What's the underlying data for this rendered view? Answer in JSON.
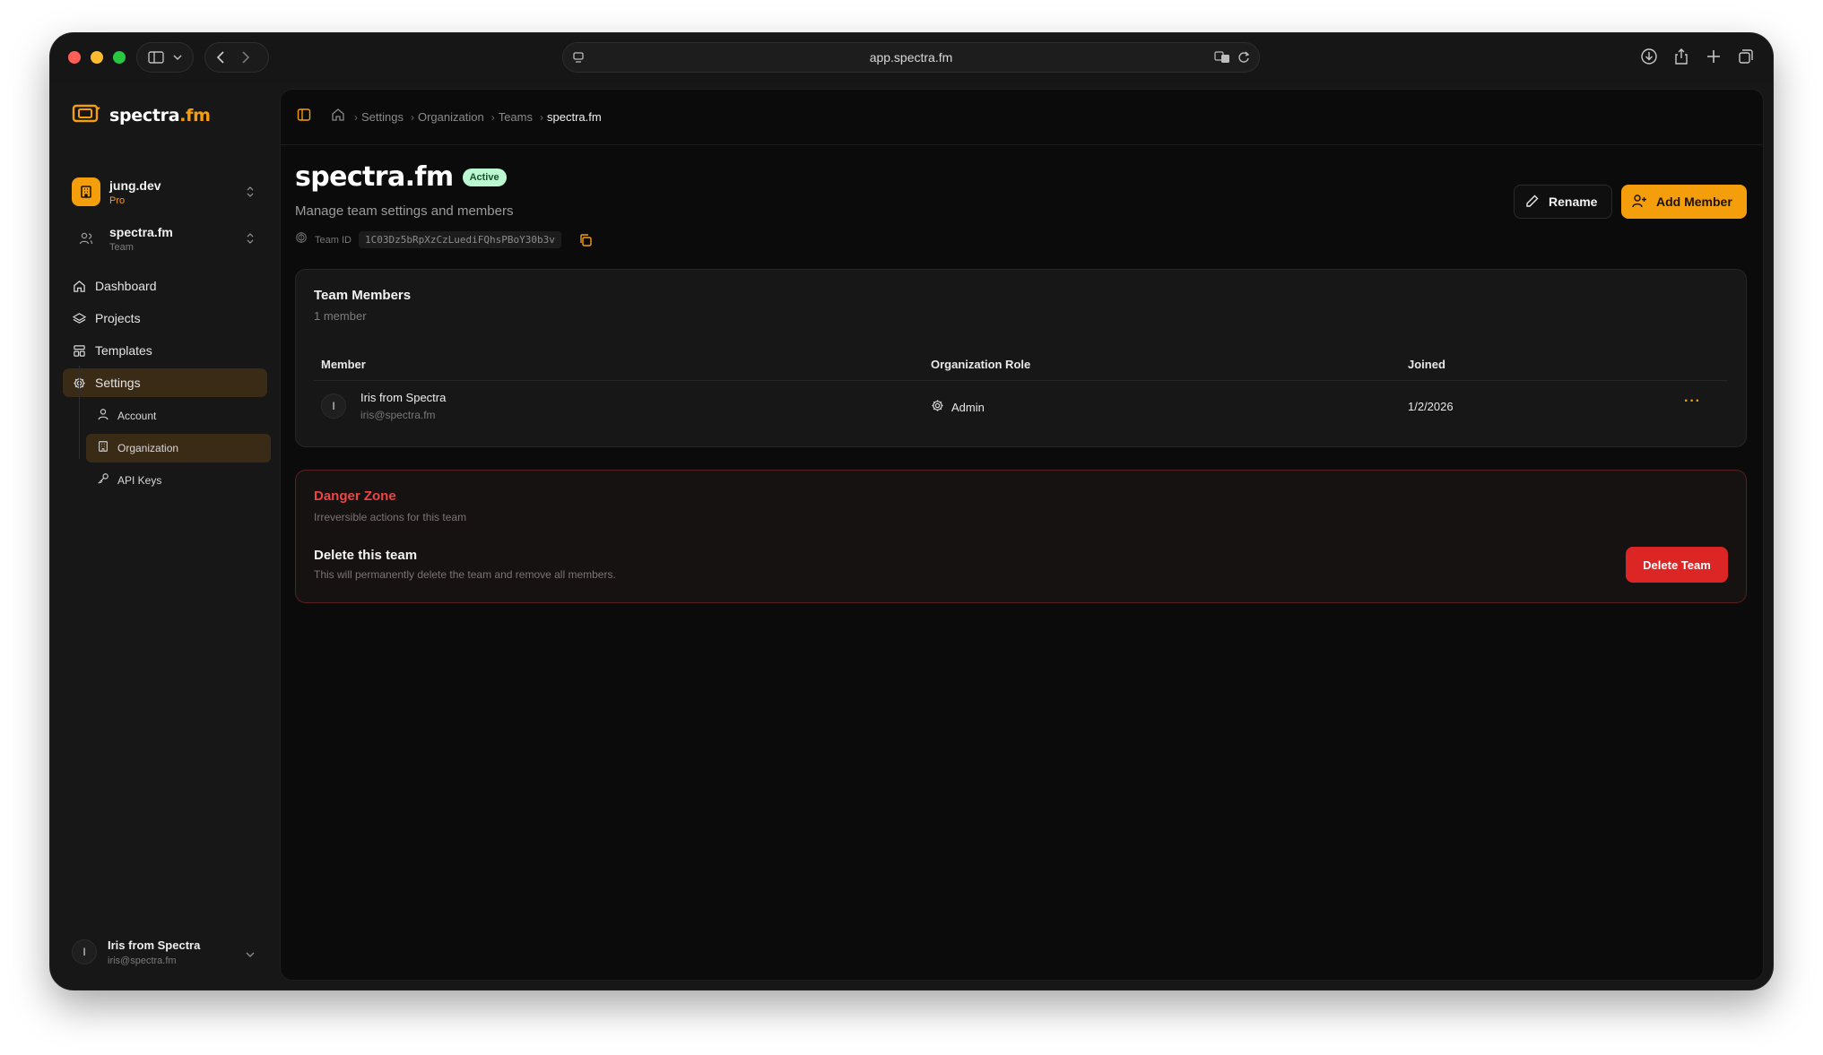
{
  "browser": {
    "url": "app.spectra.fm"
  },
  "sidebar": {
    "brand": {
      "name_main": "spectra",
      "name_accent": ".fm"
    },
    "org_switcher": {
      "name": "jung.dev",
      "plan": "Pro"
    },
    "team_switcher": {
      "name": "spectra.fm",
      "kind": "Team"
    },
    "nav": [
      {
        "label": "Dashboard",
        "icon": "home-icon"
      },
      {
        "label": "Projects",
        "icon": "layers-icon"
      },
      {
        "label": "Templates",
        "icon": "layout-icon"
      },
      {
        "label": "Settings",
        "icon": "gear-icon"
      }
    ],
    "settings_sub": [
      {
        "label": "Account",
        "icon": "user-icon"
      },
      {
        "label": "Organization",
        "icon": "building-icon"
      },
      {
        "label": "API Keys",
        "icon": "key-icon"
      }
    ],
    "user": {
      "initial": "I",
      "name": "Iris from Spectra",
      "email": "iris@spectra.fm"
    }
  },
  "breadcrumb": [
    "Settings",
    "Organization",
    "Teams",
    "spectra.fm"
  ],
  "page": {
    "title": "spectra.fm",
    "status": "Active",
    "subtitle": "Manage team settings and members",
    "team_id_label": "Team ID",
    "team_id": "1C03Dz5bRpXzCzLuediFQhsPBoY30b3v"
  },
  "actions": {
    "rename": "Rename",
    "add_member": "Add Member"
  },
  "members_card": {
    "title": "Team Members",
    "subtitle": "1 member",
    "columns": [
      "Member",
      "Organization Role",
      "Joined"
    ],
    "rows": [
      {
        "initial": "I",
        "name": "Iris from Spectra",
        "email": "iris@spectra.fm",
        "role": "Admin",
        "joined": "1/2/2026",
        "more": "···"
      }
    ]
  },
  "danger_zone": {
    "title": "Danger Zone",
    "subtitle": "Irreversible actions for this team",
    "item_title": "Delete this team",
    "item_desc": "This will permanently delete the team and remove all members.",
    "button": "Delete Team"
  },
  "colors": {
    "accent": "#f59e0b",
    "danger": "#dc2626",
    "active_badge": "#bbf7d0",
    "background": "#0b0b0b"
  }
}
